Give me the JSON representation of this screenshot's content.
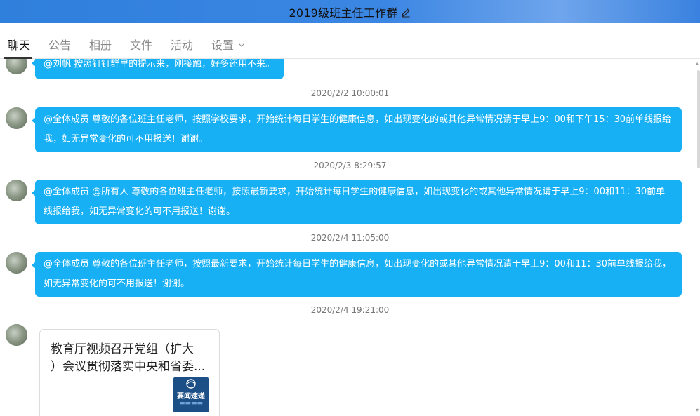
{
  "window": {
    "title": "2019级班主任工作群"
  },
  "tabs": [
    {
      "label": "聊天"
    },
    {
      "label": "公告"
    },
    {
      "label": "相册"
    },
    {
      "label": "文件"
    },
    {
      "label": "活动"
    },
    {
      "label": "设置"
    }
  ],
  "messages": [
    {
      "text": "@刘帆 按照钉钉群里的提示来，刚接触，好多还用不来。"
    },
    {
      "time": "2020/2/2 10:00:01",
      "lines": [
        "@全体成员 尊敬的各位班主任老师，按照学校要求，开始统计每日学生的健康信息，如出现变化的或其他异常情况请于早上9：00和下午15：30前单线报给",
        "我，如无异常变化的可不用报送！谢谢。"
      ]
    },
    {
      "time": "2020/2/3 8:29:57",
      "lines": [
        "@全体成员 @所有人   尊敬的各位班主任老师，按照最新要求，开始统计每日学生的健康信息，如出现变化的或其他异常情况请于早上9：00和11：30前单",
        "线报给我，如无异常变化的可不用报送！谢谢。"
      ]
    },
    {
      "time": "2020/2/4 11:05:00",
      "lines": [
        "@全体成员  尊敬的各位班主任老师，按照最新要求，开始统计每日学生的健康信息，如出现变化的或其他异常情况请于早上9：00和11：30前单线报给我，",
        "如无异常变化的可不用报送！谢谢。"
      ]
    },
    {
      "time": "2020/2/4 19:21:00",
      "card": {
        "title_line1": "教育厅视频召开党组（扩大",
        "title_line2": "）会议贯彻落实中央和省委...",
        "thumb_label": "要闻速递"
      }
    }
  ],
  "icons": {
    "edit": "pencil-icon",
    "dropdown": "chevron-down-icon"
  },
  "colors": {
    "bubble": "#17b0f5",
    "titlebar": "#3b86e3"
  }
}
